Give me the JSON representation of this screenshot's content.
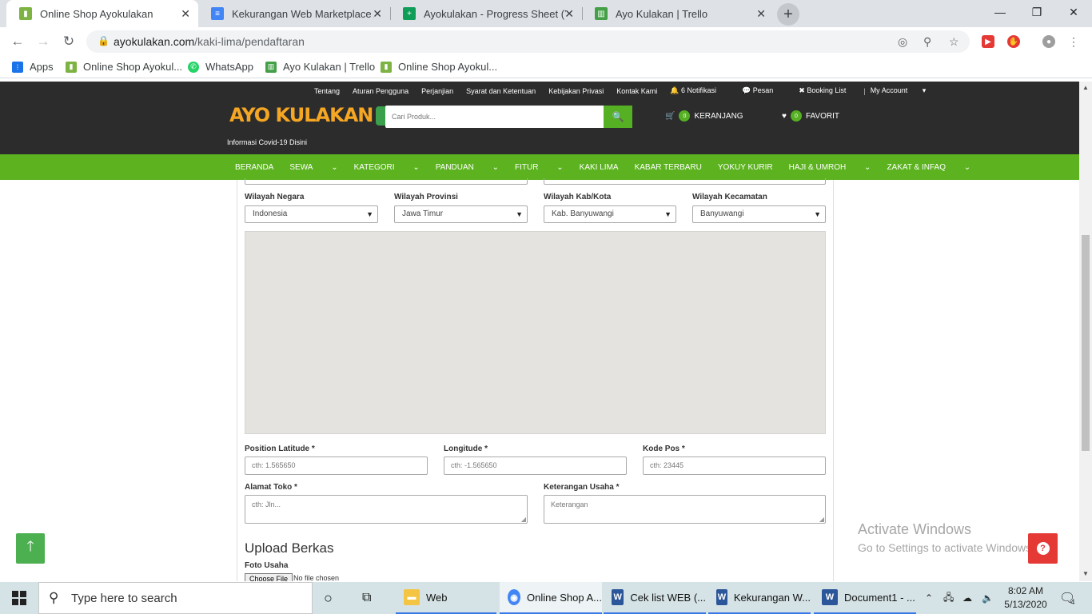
{
  "browser": {
    "tabs": [
      {
        "label": "Online Shop Ayokulakan",
        "active": true
      },
      {
        "label": "Kekurangan Web Marketplace Ay",
        "active": false
      },
      {
        "label": "Ayokulakan - Progress Sheet (Yu",
        "active": false
      },
      {
        "label": "Ayo Kulakan | Trello",
        "active": false
      }
    ],
    "url_domain": "ayokulakan.com",
    "url_path": "/kaki-lima/pendaftaran",
    "bookmarks": [
      {
        "label": "Apps"
      },
      {
        "label": "Online Shop Ayokul..."
      },
      {
        "label": "WhatsApp"
      },
      {
        "label": "Ayo Kulakan | Trello"
      },
      {
        "label": "Online Shop Ayokul..."
      }
    ]
  },
  "site": {
    "top_links": [
      "Tentang",
      "Aturan Pengguna",
      "Perjanjian",
      "Syarat dan Ketentuan",
      "Kebijakan Privasi",
      "Kontak Kami",
      "6 Notifikasi",
      "Pesan",
      "Booking List"
    ],
    "my_account": "My Account",
    "logo_text": "AYO KULAKAN",
    "covid_link": "Informasi Covid-19 Disini",
    "search_placeholder": "Cari Produk...",
    "cart_count": "0",
    "cart_label": "KERANJANG",
    "fav_count": "0",
    "fav_label": "FAVORIT",
    "nav": [
      "BERANDA",
      "SEWA",
      "KATEGORI",
      "PANDUAN",
      "FITUR",
      "KAKI LIMA",
      "KABAR TERBARU",
      "YOKUY KURIR",
      "HAJI & UMROH",
      "ZAKAT & INFAQ"
    ]
  },
  "form": {
    "negara_label": "Wilayah Negara",
    "negara_value": "Indonesia",
    "provinsi_label": "Wilayah Provinsi",
    "provinsi_value": "Jawa Timur",
    "kota_label": "Wilayah Kab/Kota",
    "kota_value": "Kab. Banyuwangi",
    "kecamatan_label": "Wilayah Kecamatan",
    "kecamatan_value": "Banyuwangi",
    "lat_label": "Position Latitude *",
    "lat_placeholder": "cth: 1.565650",
    "lng_label": "Longitude *",
    "lng_placeholder": "cth: -1.565650",
    "kodepos_label": "Kode Pos *",
    "kodepos_placeholder": "cth: 23445",
    "alamat_label": "Alamat Toko *",
    "alamat_placeholder": "cth: Jln...",
    "keterangan_label": "Keterangan Usaha *",
    "keterangan_placeholder": "Keterangan",
    "upload_heading": "Upload Berkas",
    "foto_label": "Foto Usaha",
    "choose_file": "Choose File",
    "no_file": "No file chosen"
  },
  "windows_watermark": {
    "line1": "Activate Windows",
    "line2": "Go to Settings to activate Windows."
  },
  "taskbar": {
    "search_placeholder": "Type here to search",
    "apps": [
      {
        "label": "Web"
      },
      {
        "label": "Online Shop A..."
      },
      {
        "label": "Cek list WEB (..."
      },
      {
        "label": "Kekurangan W..."
      },
      {
        "label": "Document1 - ..."
      }
    ],
    "time": "8:02 AM",
    "date": "5/13/2020",
    "notification_count": "4"
  }
}
